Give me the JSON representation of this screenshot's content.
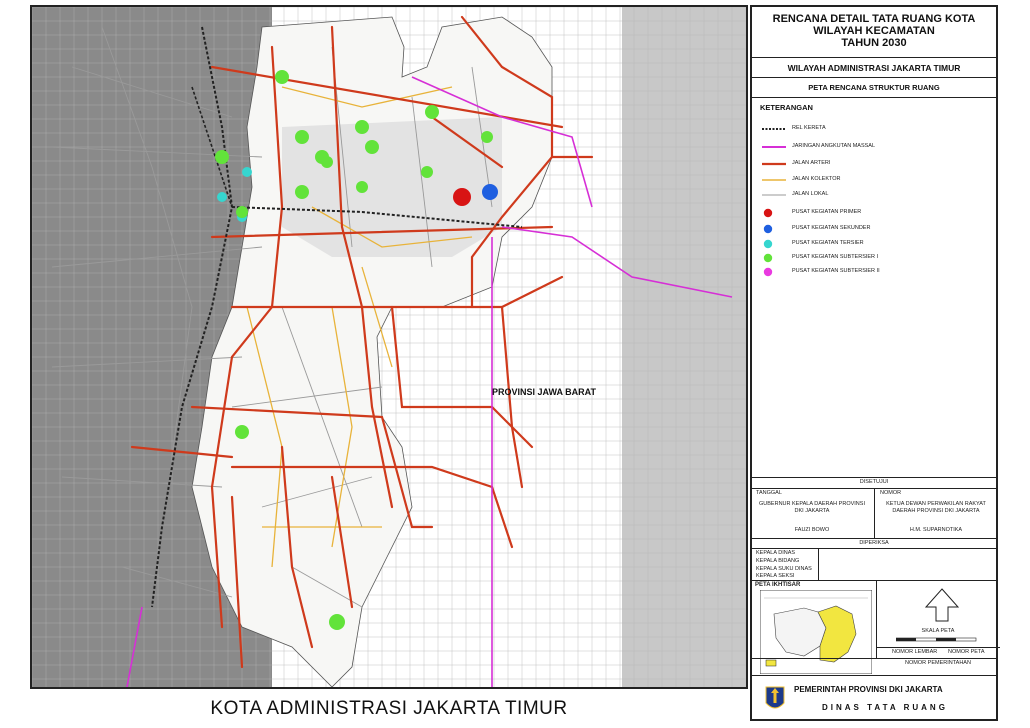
{
  "map": {
    "region_label": "PROVINSI JAWA BARAT",
    "footer_title": "KOTA ADMINISTRASI JAKARTA TIMUR",
    "colors": {
      "background": "#ffffff",
      "outside_area": "#8a8a8a",
      "east_area": "#c8c8c8",
      "grid": "#b5b5b5",
      "rail": "#222222",
      "mass_transit": "#d62fd6",
      "arterial": "#cf3a1c",
      "collector": "#e8b33a",
      "local": "#9a9a9a",
      "primary_center": "#d81414",
      "secondary_center": "#1f5fe0",
      "tertiary_center": "#36d6cf",
      "subtertiary1_center": "#62e33a",
      "subtertiary2_center": "#e93ae0"
    }
  },
  "legend": {
    "title_lines": [
      "RENCANA DETAIL TATA RUANG KOTA",
      "WILAYAH KECAMATAN",
      "TAHUN 2030"
    ],
    "subtitle": "WILAYAH ADMINISTRASI JAKARTA TIMUR",
    "map_name": "PETA RENCANA STRUKTUR RUANG",
    "keterangan": "KETERANGAN",
    "lines": [
      {
        "label": "REL KERETA",
        "style": "rail"
      },
      {
        "label": "JARINGAN ANGKUTAN MASSAL",
        "style": "mass_transit"
      },
      {
        "label": "JALAN ARTERI",
        "style": "arterial"
      },
      {
        "label": "JALAN KOLEKTOR",
        "style": "collector"
      },
      {
        "label": "JALAN LOKAL",
        "style": "local"
      }
    ],
    "points": [
      {
        "label": "PUSAT KEGIATAN PRIMER",
        "style": "primary_center"
      },
      {
        "label": "PUSAT KEGIATAN SEKUNDER",
        "style": "secondary_center"
      },
      {
        "label": "PUSAT KEGIATAN TERSIER",
        "style": "tertiary_center"
      },
      {
        "label": "PUSAT KEGIATAN SUBTERSIER I",
        "style": "subtertiary1_center"
      },
      {
        "label": "PUSAT KEGIATAN SUBTERSIER II",
        "style": "subtertiary2_center"
      }
    ],
    "approval": {
      "heading": "DISETUJUI",
      "date_label": "TANGGAL",
      "number_label": "NOMOR",
      "left_role": "GUBERNUR KEPALA DAERAH PROVINSI DKI JAKARTA",
      "right_role": "KETUA DEWAN PERWAKILAN RAKYAT DAERAH PROVINSI DKI JAKARTA",
      "left_name": "FAUZI BOWO",
      "right_name": "H.M. SUPARNOTIKA"
    },
    "checked": {
      "heading": "DIPERIKSA",
      "rows": [
        "KEPALA DINAS",
        "KEPALA BIDANG",
        "KEPALA SUKU DINAS",
        "KEPALA SEKSI"
      ]
    },
    "index_map": {
      "title": "PETA IKHTISAR"
    },
    "scale_label": "SKALA PETA",
    "sheet_labels": [
      "NOMOR LEMBAR",
      "NOMOR PETA"
    ],
    "doc_label": "NOMOR PEMERINTAHAN",
    "org_line1": "PEMERINTAH PROVINSI DKI JAKARTA",
    "org_line2": "DINAS TATA RUANG"
  }
}
